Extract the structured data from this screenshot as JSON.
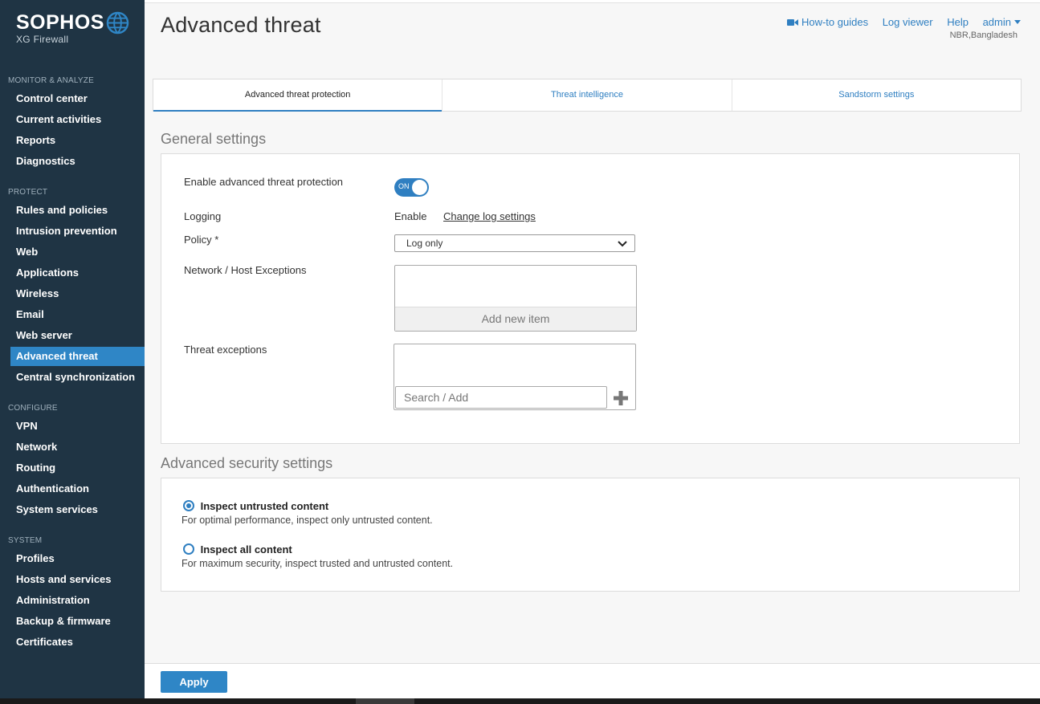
{
  "brand": {
    "name": "SOPHOS",
    "product": "XG Firewall"
  },
  "sidebar": {
    "sections": [
      {
        "title": "MONITOR & ANALYZE",
        "items": [
          "Control center",
          "Current activities",
          "Reports",
          "Diagnostics"
        ]
      },
      {
        "title": "PROTECT",
        "items": [
          "Rules and policies",
          "Intrusion prevention",
          "Web",
          "Applications",
          "Wireless",
          "Email",
          "Web server",
          "Advanced threat",
          "Central synchronization"
        ]
      },
      {
        "title": "CONFIGURE",
        "items": [
          "VPN",
          "Network",
          "Routing",
          "Authentication",
          "System services"
        ]
      },
      {
        "title": "SYSTEM",
        "items": [
          "Profiles",
          "Hosts and services",
          "Administration",
          "Backup & firmware",
          "Certificates"
        ]
      }
    ],
    "active": "Advanced threat"
  },
  "header": {
    "title": "Advanced threat",
    "links": {
      "howto": "How-to guides",
      "logviewer": "Log viewer",
      "help": "Help",
      "admin": "admin"
    },
    "location": "NBR,Bangladesh"
  },
  "tabs": [
    "Advanced threat protection",
    "Threat intelligence",
    "Sandstorm settings"
  ],
  "general": {
    "title": "General settings",
    "enable_label": "Enable advanced threat protection",
    "toggle_text": "ON",
    "logging_label": "Logging",
    "logging_value": "Enable",
    "logging_link": "Change log settings",
    "policy_label": "Policy *",
    "policy_value": "Log only",
    "net_exceptions_label": "Network / Host Exceptions",
    "add_new_item": "Add new item",
    "threat_exceptions_label": "Threat exceptions",
    "search_placeholder": "Search / Add"
  },
  "advanced": {
    "title": "Advanced security settings",
    "opt1_label": "Inspect untrusted content",
    "opt1_desc": "For optimal performance, inspect only untrusted content.",
    "opt2_label": "Inspect all content",
    "opt2_desc": "For maximum security, inspect trusted and untrusted content."
  },
  "footer": {
    "apply": "Apply"
  },
  "colors": {
    "sidebar": "#1f3444",
    "accent": "#2f7fc1",
    "active": "#2f86c6"
  }
}
